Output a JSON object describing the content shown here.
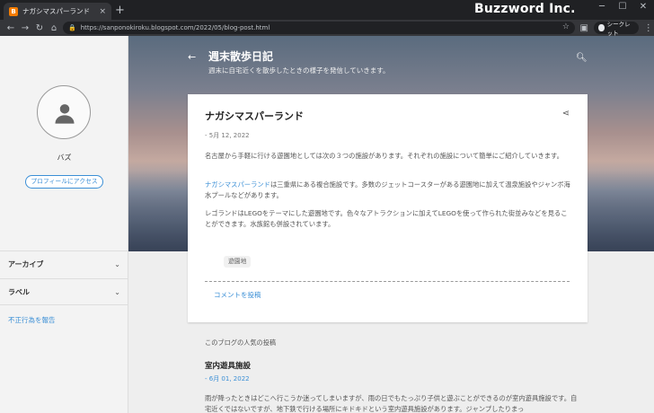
{
  "browser": {
    "tab_title": "ナガシマスパーランド",
    "tab_close": "×",
    "new_tab": "+",
    "brand": "Buzzword Inc.",
    "url": "https://sanponokiroku.blogspot.com/2022/05/blog-post.html",
    "incognito_label": "シークレット"
  },
  "sidebar": {
    "author_name": "バズ",
    "profile_button": "プロフィールにアクセス",
    "sections": [
      {
        "label": "アーカイブ"
      },
      {
        "label": "ラベル"
      }
    ],
    "report_link": "不正行為を報告"
  },
  "header": {
    "title": "週末散歩日記",
    "description": "週末に自宅近くを散歩したときの様子を発信していきます。"
  },
  "post": {
    "title": "ナガシマスパーランド",
    "date": "- 5月 12, 2022",
    "para1": "名古屋から手軽に行ける遊園地としては次の３つの施設があります。それぞれの施設について簡単にご紹介していきます。",
    "para2_link": "ナガシマスパーランド",
    "para2_rest": "は三重県にある複合施設です。多数のジェットコースターがある遊園地に加えて温泉施設やジャンボ海水プールなどがあります。",
    "para3": "レゴランドはLEGOをテーマにした遊園地です。色々なアトラクションに加えてLEGOを使って作られた街並みなどを見ることができます。水族館も併設されています。",
    "tag": "遊園地",
    "comment_link": "コメントを投稿"
  },
  "popular": {
    "heading": "このブログの人気の投稿",
    "title": "室内遊具施設",
    "date": "- 6月 01, 2022",
    "text": "雨が降ったときはどこへ行こうか迷ってしまいますが、雨の日でもたっぷり子供と遊ぶことができるのが室内遊具施設です。自宅近くではないですが、地下鉄で行ける場所にキドキドという室内遊具施設があります。ジャンプしたりまっ"
  },
  "colors": {
    "accent": "#3b8fd6",
    "titlebar": "#202124",
    "sidebar_bg": "#f3f3f3"
  }
}
